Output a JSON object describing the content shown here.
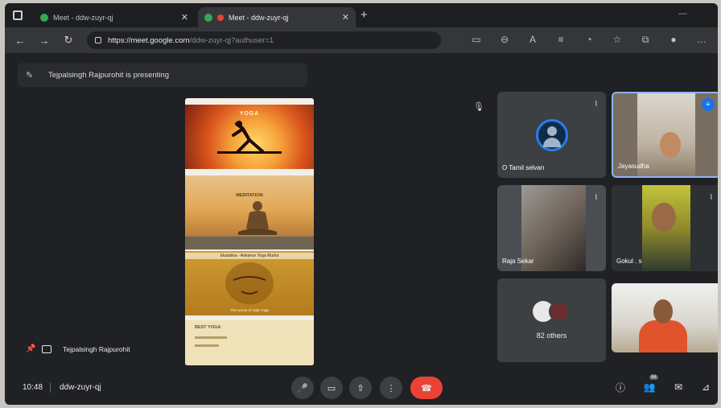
{
  "browser": {
    "tabs": [
      {
        "label": "Meet - ddw-zuyr-qj",
        "active": false
      },
      {
        "label": "Meet - ddw-zuyr-qj",
        "active": true
      }
    ],
    "url_host": "https://meet.google.com",
    "url_path": "/ddw-zuyr-qj?authuser=1"
  },
  "meet": {
    "presenting_text": "Tejpalsingh Rajpurohit is presenting",
    "slides": {
      "s1_title": "YOGA",
      "s2_title": "MEDITATION",
      "s3_top": "Ekatattva - Advance Yoga Mudra",
      "s3_bottom": "The secret of Kala Yoga",
      "s4_title": "BEST YOGA"
    },
    "participants": [
      {
        "name": "O Tamil selvan"
      },
      {
        "name": "Jayasudha"
      },
      {
        "name": "Raja Sekar"
      },
      {
        "name": "Gokul . s"
      }
    ],
    "others_label": "82 others",
    "self_name": "Tejpalsingh Rajpurohit",
    "time": "10:48",
    "meeting_code": "ddw-zuyr-qj",
    "people_count": "88"
  }
}
